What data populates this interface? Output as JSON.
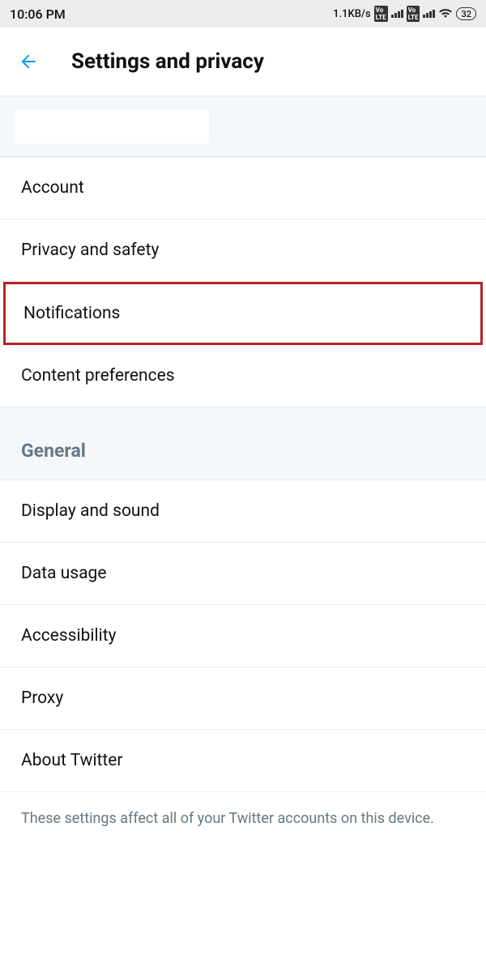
{
  "status": {
    "time": "10:06 PM",
    "net_speed": "1.1KB/s",
    "vo_badge": "Vo LTE",
    "battery": "32"
  },
  "header": {
    "title": "Settings and privacy"
  },
  "items": {
    "account": "Account",
    "privacy": "Privacy and safety",
    "notifications": "Notifications",
    "content_prefs": "Content preferences"
  },
  "section_general": "General",
  "general_items": {
    "display": "Display and sound",
    "data": "Data usage",
    "accessibility": "Accessibility",
    "proxy": "Proxy",
    "about": "About Twitter"
  },
  "footer": "These settings affect all of your Twitter accounts on this device."
}
